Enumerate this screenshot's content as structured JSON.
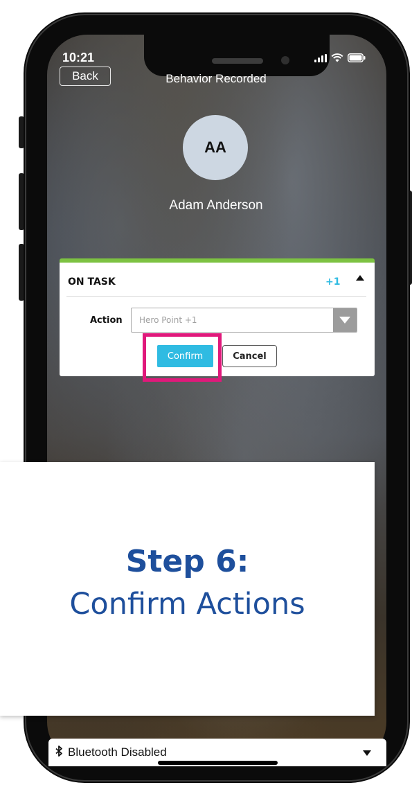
{
  "status_bar": {
    "time": "10:21"
  },
  "header": {
    "back_label": "Back",
    "title": "Behavior Recorded"
  },
  "student": {
    "initials": "AA",
    "name": "Adam Anderson"
  },
  "behavior_card": {
    "behavior_name": "ON TASK",
    "points": "+1",
    "accent_color": "#7dc242",
    "action_label": "Action",
    "action_value": "Hero Point +1",
    "confirm_label": "Confirm",
    "cancel_label": "Cancel"
  },
  "step_panel": {
    "title": "Step 6:",
    "subtitle": "Confirm Actions",
    "text_color": "#1e4f9c"
  },
  "bluetooth_bar": {
    "icon": "bluetooth-icon",
    "label": "Bluetooth Disabled"
  },
  "colors": {
    "highlight": "#e0197b",
    "primary_button": "#2fbbe2"
  }
}
